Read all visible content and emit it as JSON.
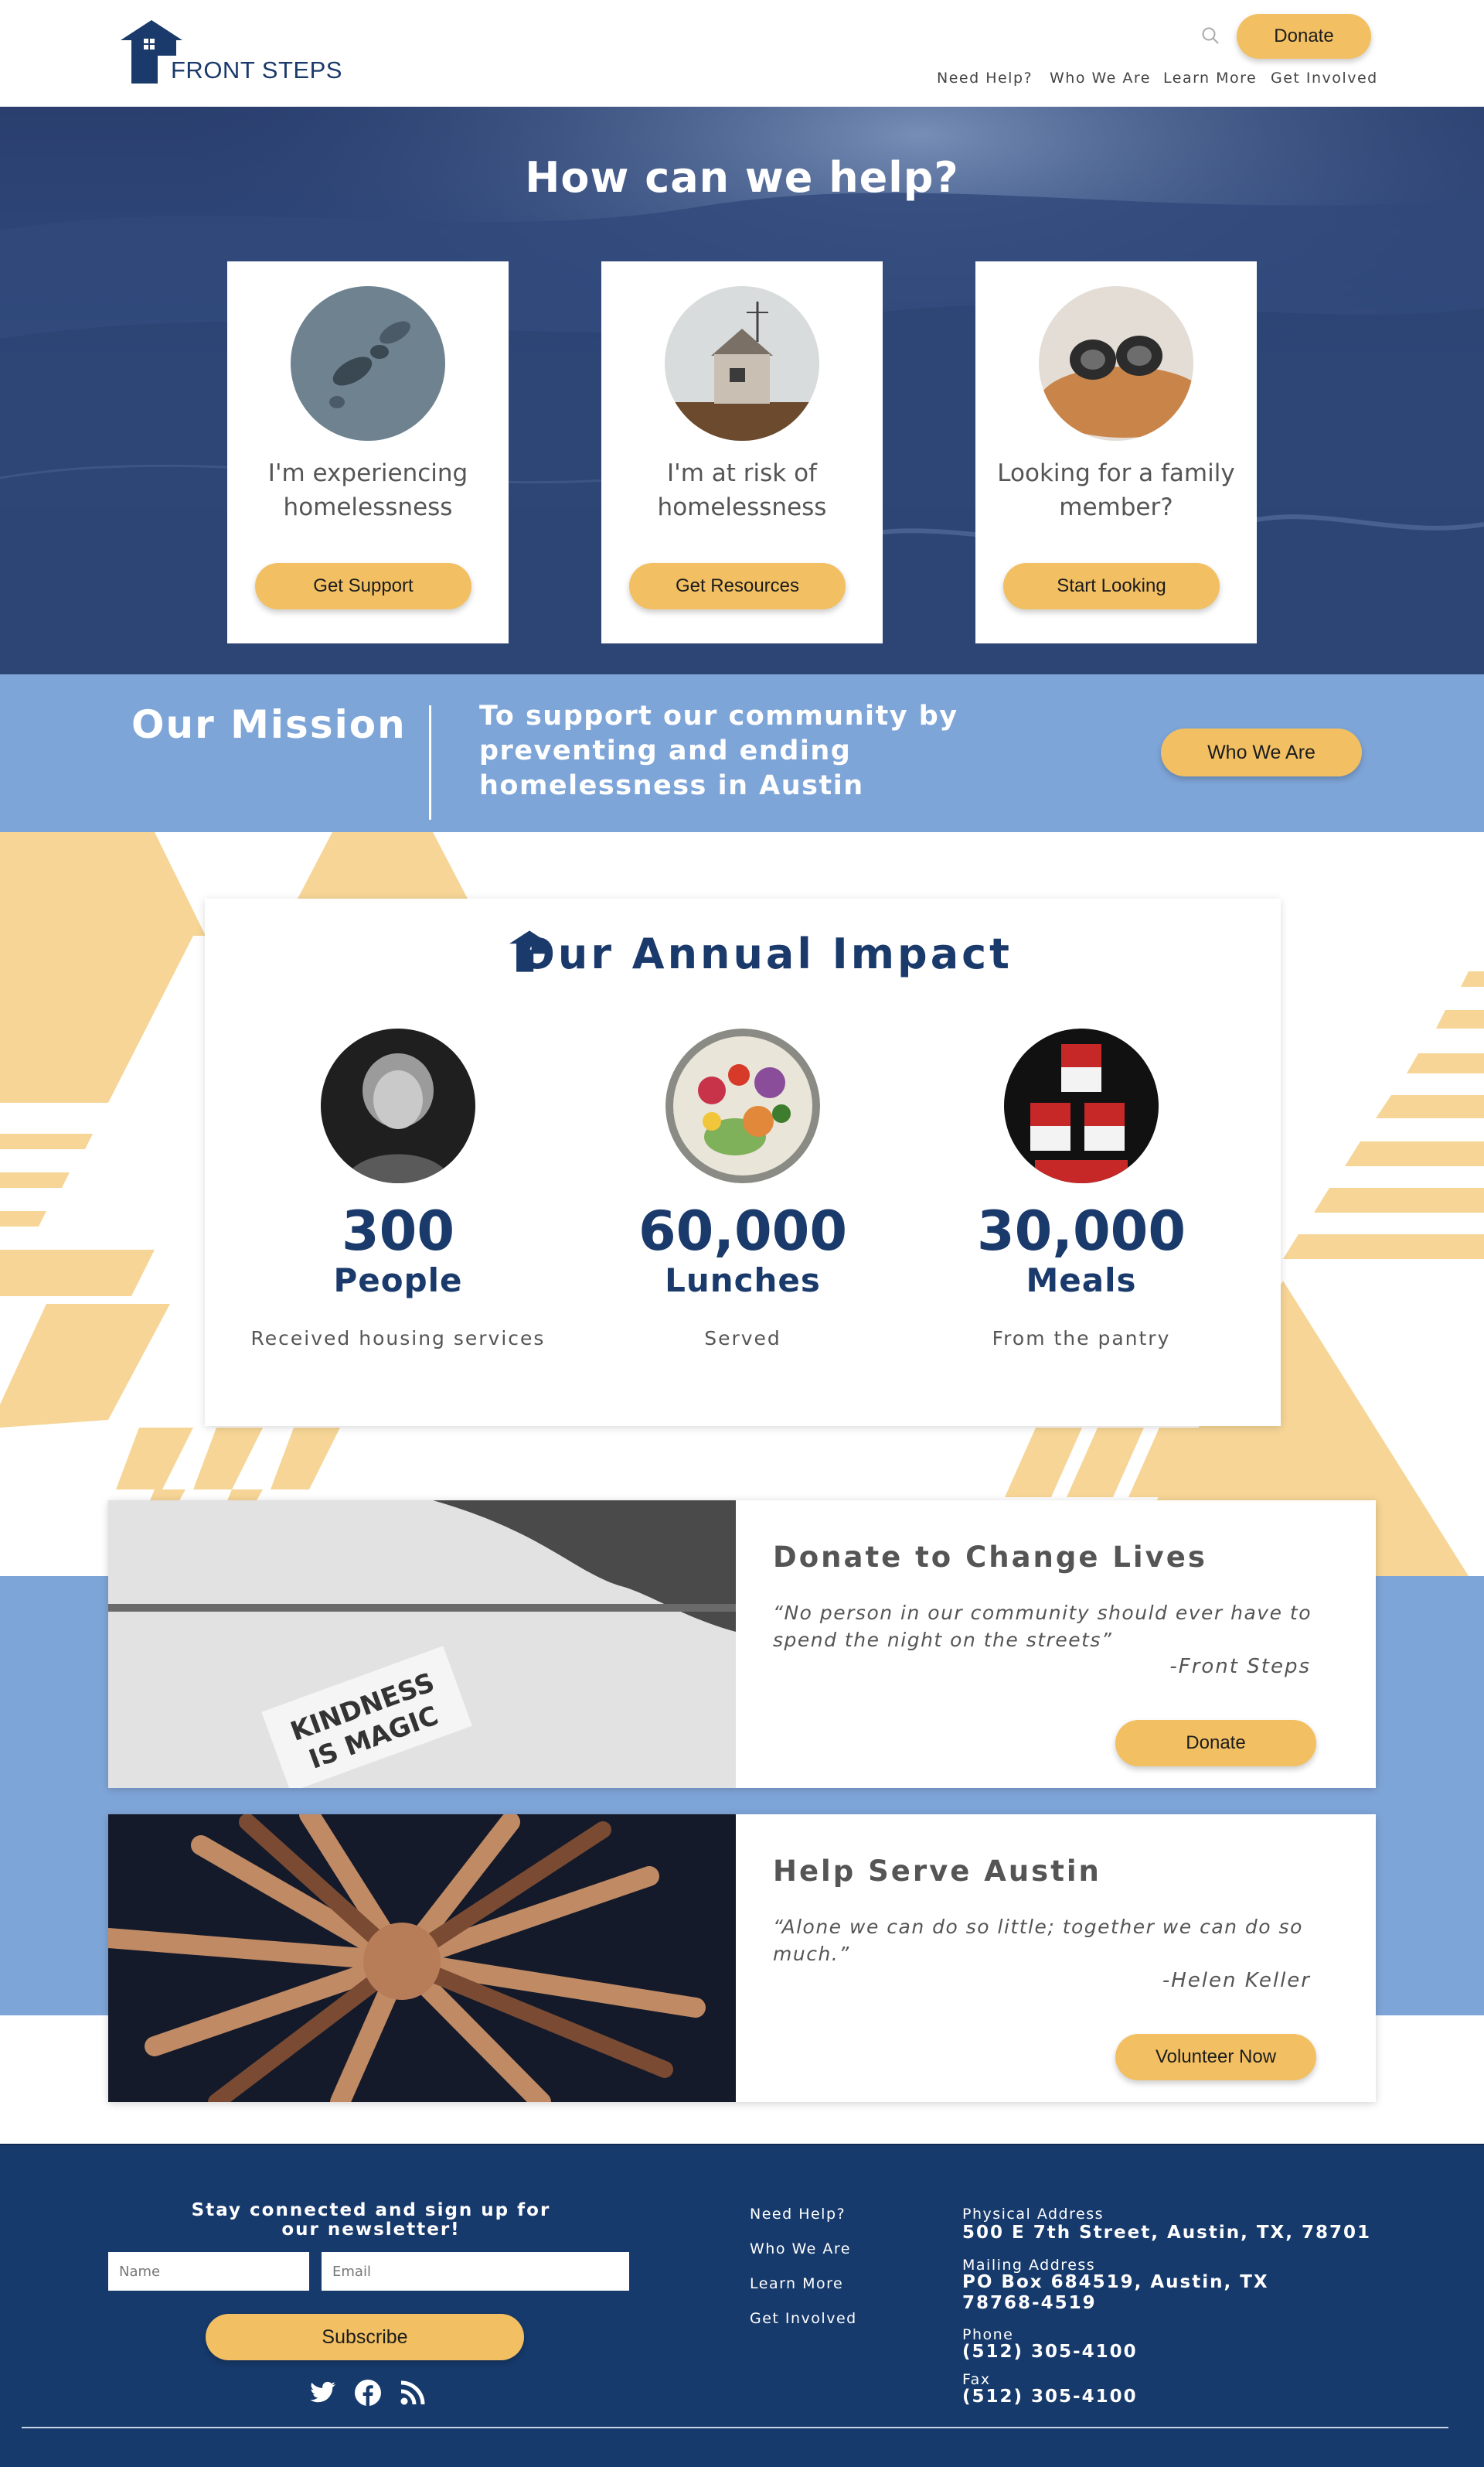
{
  "brand": {
    "name": "FRONT STEPS",
    "navy": "#1a3a6b",
    "yellow": "#f2c063",
    "light_blue": "#7ea5d8",
    "footer_navy": "#173a6c"
  },
  "header": {
    "donate_label": "Donate",
    "search_icon": "search-icon",
    "nav": [
      "Need Help?",
      "Who We Are",
      "Learn More",
      "Get Involved"
    ]
  },
  "hero": {
    "title": "How can we help?",
    "cards": [
      {
        "photo": "footprints-in-snow",
        "text": "I'm experiencing homelessness",
        "button": "Get Support"
      },
      {
        "photo": "small-shed-on-hill",
        "text": "I'm at risk of homelessness",
        "button": "Get Resources"
      },
      {
        "photo": "binoculars",
        "text": "Looking for a family member?",
        "button": "Start Looking"
      }
    ]
  },
  "mission": {
    "title": "Our Mission",
    "text": "To support our community by preventing and ending homelessness in Austin",
    "button": "Who We Are"
  },
  "impact": {
    "title": "Our Annual Impact",
    "stats": [
      {
        "photo": "portrait-older-woman",
        "number": "300",
        "unit": "People",
        "desc": "Received housing services"
      },
      {
        "photo": "bowl-of-vegetables",
        "number": "60,000",
        "unit": "Lunches",
        "desc": "Served"
      },
      {
        "photo": "stacked-soup-cans",
        "number": "30,000",
        "unit": "Meals",
        "desc": "From the pantry"
      }
    ]
  },
  "features": [
    {
      "photo": "kindness-is-magic-card",
      "photo_text": "KINDNESS IS MAGIC",
      "title": "Donate to Change Lives",
      "quote": "“No person in our community should ever have to spend the night on the streets”",
      "author": "-Front Steps",
      "button": "Donate"
    },
    {
      "photo": "stacked-hands-circle",
      "title": "Help Serve Austin",
      "quote": "“Alone we can do so little; together we can do so much.”",
      "author": "-Helen Keller",
      "button": "Volunteer Now"
    }
  ],
  "footer": {
    "newsletter_title": "Stay connected and sign up for our newsletter!",
    "name_placeholder": "Name",
    "email_placeholder": "Email",
    "subscribe": "Subscribe",
    "links": [
      "Need Help?",
      "Who We Are",
      "Learn More",
      "Get Involved"
    ],
    "physical_label": "Physical Address",
    "physical_value": "500 E 7th Street, Austin, TX, 78701",
    "mailing_label": "Mailing Address",
    "mailing_value": "PO Box 684519, Austin, TX 78768-4519",
    "phone_label": "Phone",
    "phone_value": "(512) 305-4100",
    "fax_label": "Fax",
    "fax_value": "(512) 305-4100",
    "social": [
      "twitter-icon",
      "facebook-icon",
      "rss-icon"
    ]
  }
}
